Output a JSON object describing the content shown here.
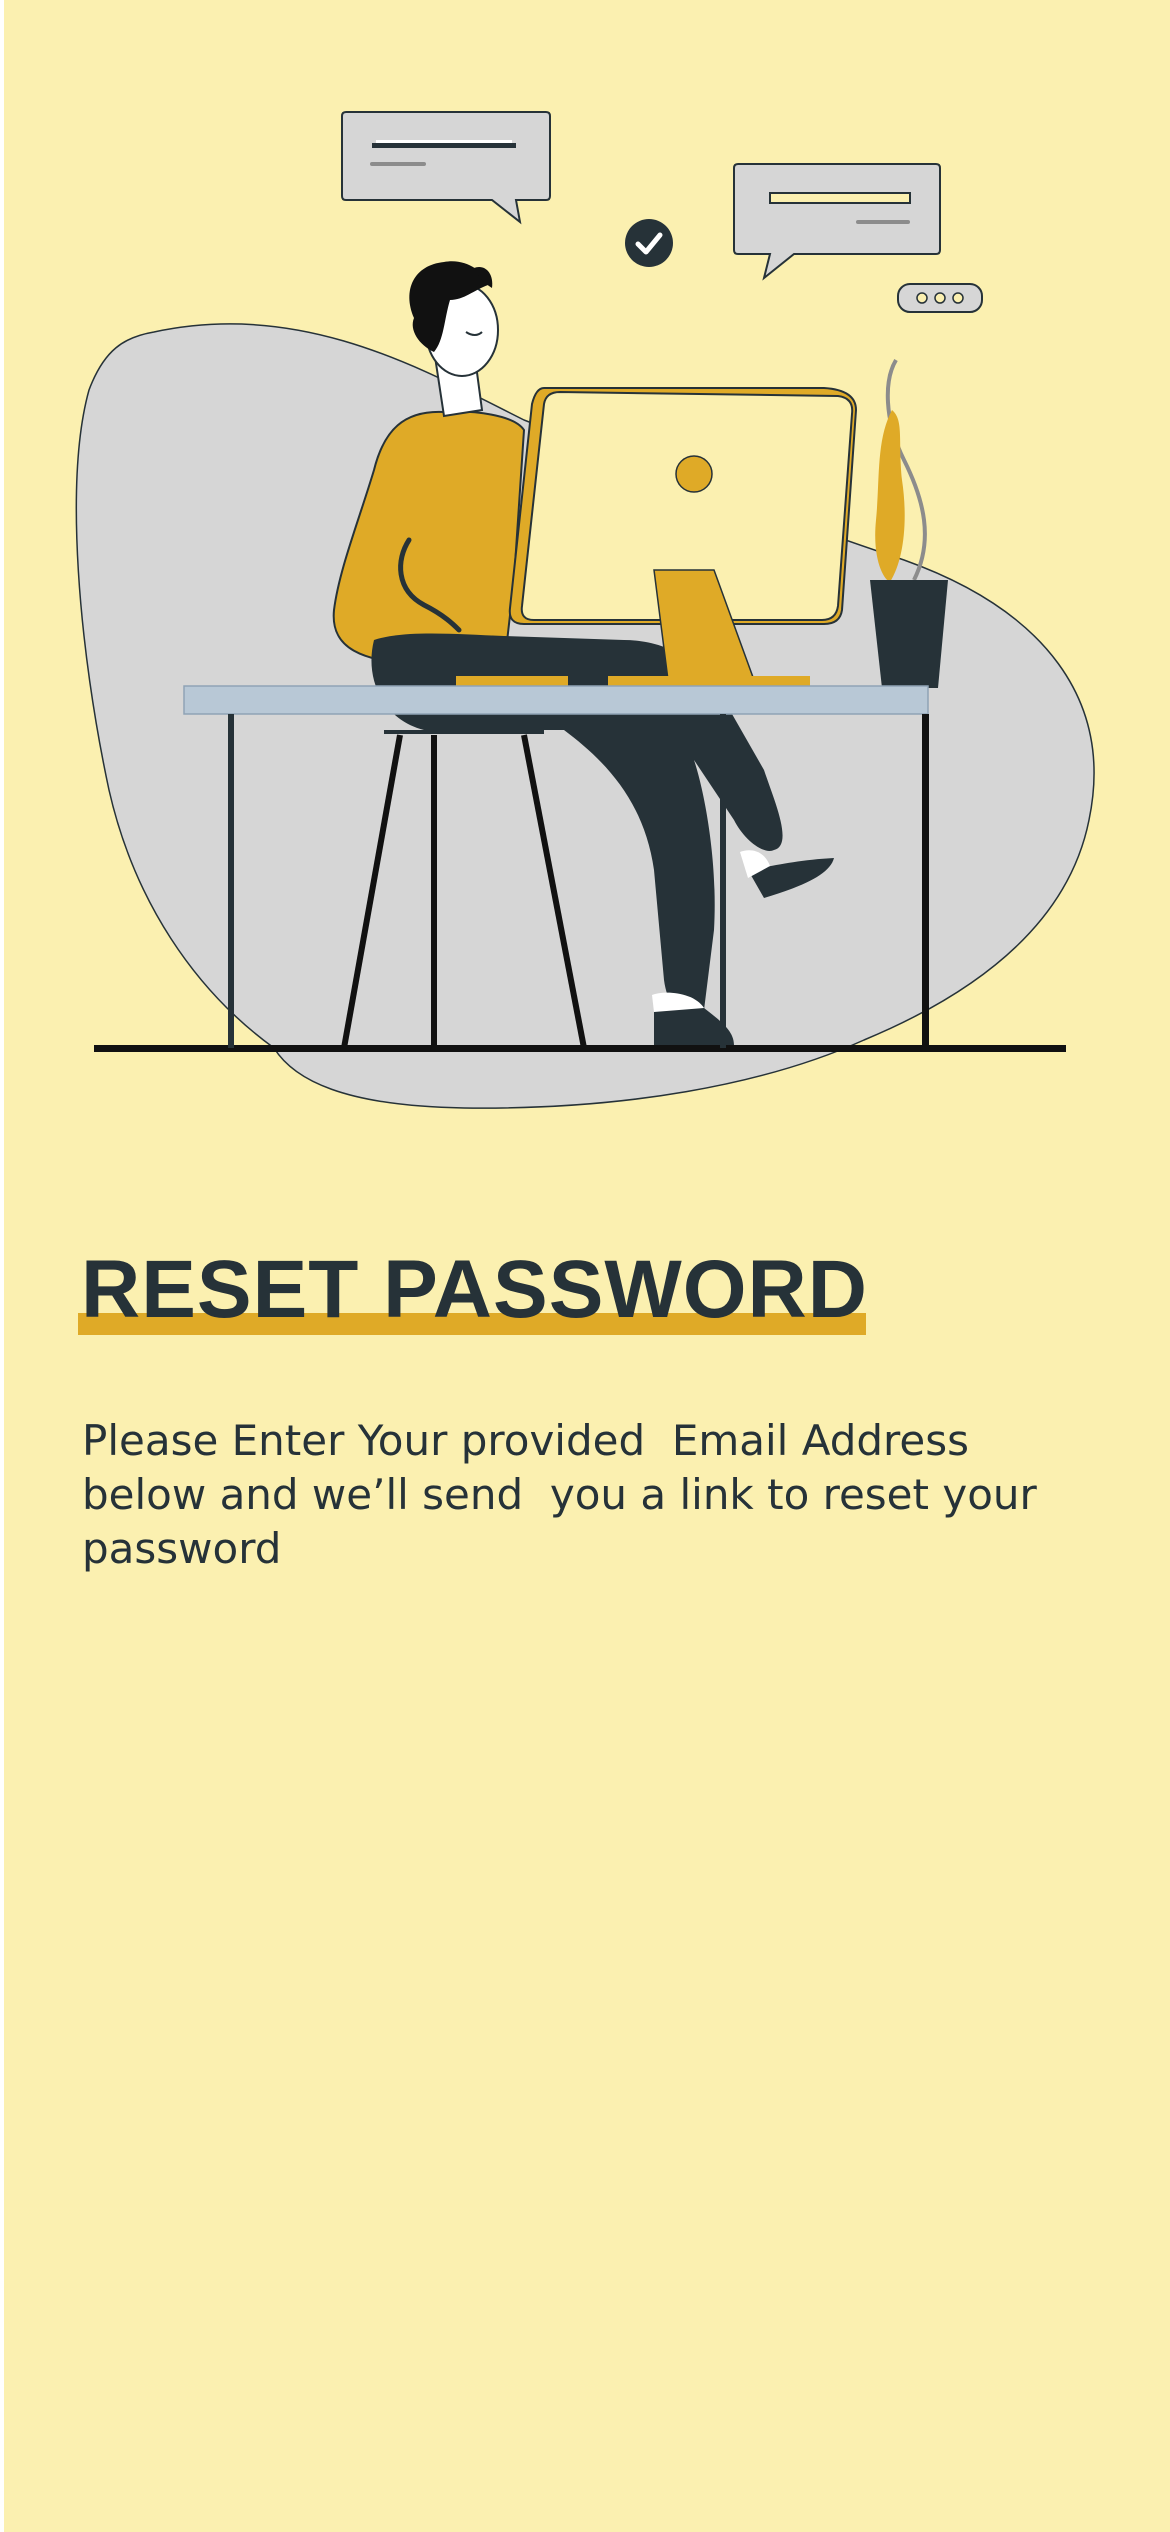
{
  "screen": {
    "title": "RESET PASSWORD",
    "description": "Please Enter Your provided  Email Address below and we’ll send  you a link to reset your password"
  },
  "colors": {
    "background": "#fbf0b0",
    "accent": "#dfaa27",
    "dark": "#263238",
    "blob": "#d6d6d6",
    "desk": "#b8c8d6"
  },
  "illustration": {
    "name": "person-working-at-computer-illustration"
  }
}
